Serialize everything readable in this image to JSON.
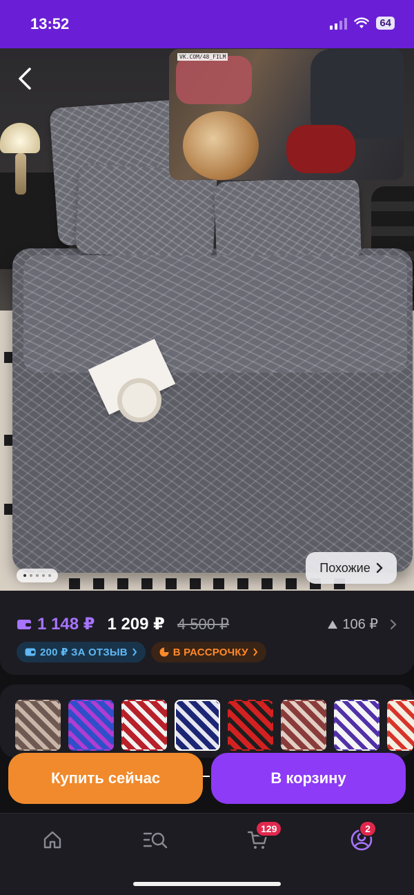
{
  "status_bar": {
    "time": "13:52",
    "battery": "64"
  },
  "hero": {
    "video_watermark": "VK.COM/48_FILM",
    "similar_label": "Похожие",
    "carousel_total": 5,
    "carousel_active": 1
  },
  "price": {
    "wallet_price": "1 148 ₽",
    "price": "1 209 ₽",
    "old_price": "4 500 ₽",
    "discount": "106 ₽",
    "review_chip": "200 ₽ ЗА ОТЗЫВ",
    "installment_chip": "В РАССРОЧКУ"
  },
  "variants": [
    {
      "name": "variant-1",
      "colors": [
        "#6e5a52",
        "#c9b6a8"
      ]
    },
    {
      "name": "variant-2",
      "colors": [
        "#2e4fc8",
        "#b03cd1"
      ]
    },
    {
      "name": "variant-3",
      "colors": [
        "#b8202a",
        "#f2f2f2"
      ]
    },
    {
      "name": "variant-4",
      "colors": [
        "#1c2675",
        "#e6e6ef"
      ]
    },
    {
      "name": "variant-5",
      "colors": [
        "#d32121",
        "#1e1e1e"
      ]
    },
    {
      "name": "variant-6",
      "colors": [
        "#8a3c3a",
        "#e2cfc4"
      ]
    },
    {
      "name": "variant-7",
      "colors": [
        "#f5f5f5",
        "#5231a8"
      ]
    },
    {
      "name": "variant-8",
      "colors": [
        "#f4efe3",
        "#d8342a"
      ]
    }
  ],
  "actions": {
    "buy_now": "Купить сейчас",
    "add_to_cart": "В корзину"
  },
  "bottom_nav": {
    "cart_badge": "129",
    "profile_badge": "2"
  },
  "colors": {
    "accent": "#8d3bf6",
    "orange": "#f08a2c",
    "status_bar": "#6a1fd6",
    "badge": "#e0284d"
  }
}
